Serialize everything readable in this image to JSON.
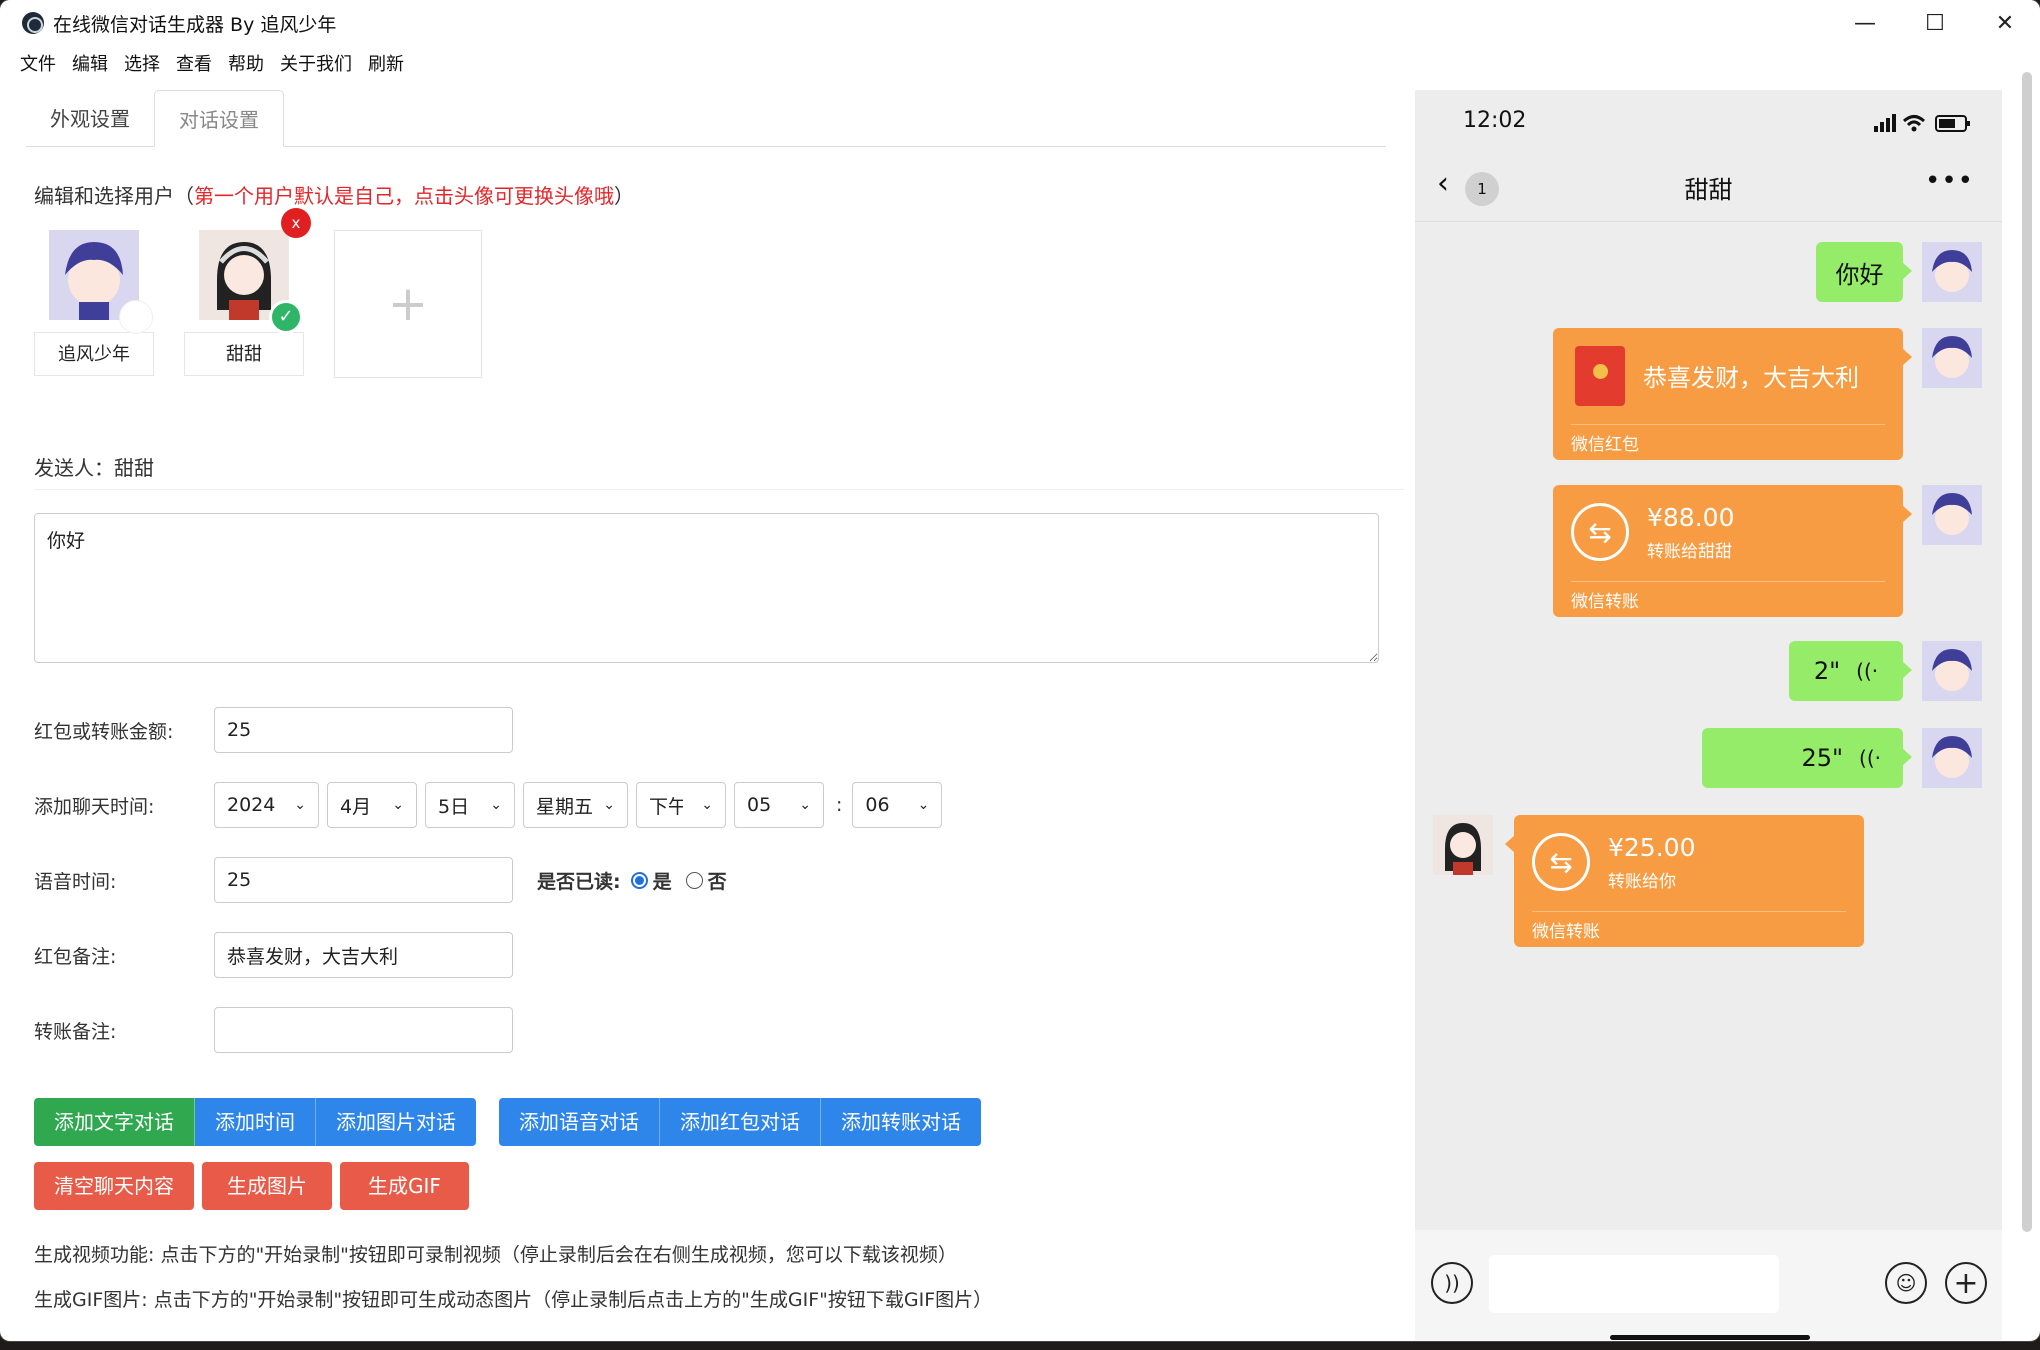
{
  "window": {
    "title": "在线微信对话生成器 By 追风少年"
  },
  "menu": [
    "文件",
    "编辑",
    "选择",
    "查看",
    "帮助",
    "关于我们",
    "刷新"
  ],
  "tabs": [
    "外观设置",
    "对话设置"
  ],
  "hint": {
    "prefix": "编辑和选择用户（",
    "red": "第一个用户默认是自己，点击头像可更换头像哦",
    "suffix": "）"
  },
  "users": [
    {
      "name": "追风少年"
    },
    {
      "name": "甜甜"
    }
  ],
  "add_user": "+",
  "delete_mark": "x",
  "sender": {
    "label": "发送人：",
    "name": "甜甜"
  },
  "message_text": "你好",
  "form": {
    "amount_label": "红包或转账金额:",
    "amount_value": "25",
    "time_label": "添加聊天时间:",
    "year": "2024",
    "month": "4月",
    "day": "5日",
    "weekday": "星期五",
    "ampm": "下午",
    "hour": "05",
    "colon": ":",
    "minute": "06",
    "voice_label": "语音时间:",
    "voice_value": "25",
    "read_label": "是否已读:",
    "read_yes": "是",
    "read_no": "否",
    "hongbao_note_label": "红包备注:",
    "hongbao_note_value": "恭喜发财，大吉大利",
    "transfer_note_label": "转账备注:",
    "transfer_note_value": ""
  },
  "buttons": {
    "add_text": "添加文字对话",
    "add_time": "添加时间",
    "add_image": "添加图片对话",
    "add_voice": "添加语音对话",
    "add_hongbao": "添加红包对话",
    "add_transfer": "添加转账对话",
    "clear": "清空聊天内容",
    "gen_image": "生成图片",
    "gen_gif": "生成GIF"
  },
  "info": {
    "video": "生成视频功能: 点击下方的\"开始录制\"按钮即可录制视频（停止录制后会在右侧生成视频，您可以下载该视频）",
    "gif": "生成GIF图片: 点击下方的\"开始录制\"按钮即可生成动态图片（停止录制后点击上方的\"生成GIF\"按钮下载GIF图片）"
  },
  "phone": {
    "time": "12:02",
    "unread": "1",
    "chat_title": "甜甜",
    "more": "•••",
    "messages": {
      "m1": "你好",
      "m2_text": "恭喜发财，大吉大利",
      "m2_foot": "微信红包",
      "m3_amount": "¥88.00",
      "m3_sub": "转账给甜甜",
      "m3_foot": "微信转账",
      "m4": "2\"",
      "m5": "25\"",
      "m6_amount": "¥25.00",
      "m6_sub": "转账给你",
      "m6_foot": "微信转账"
    }
  },
  "colors": {
    "green_bubble": "#95ec69",
    "orange_card": "#f79c42",
    "btn_green": "#2fa84f",
    "btn_blue": "#2f86ea",
    "btn_red": "#e75b48"
  }
}
